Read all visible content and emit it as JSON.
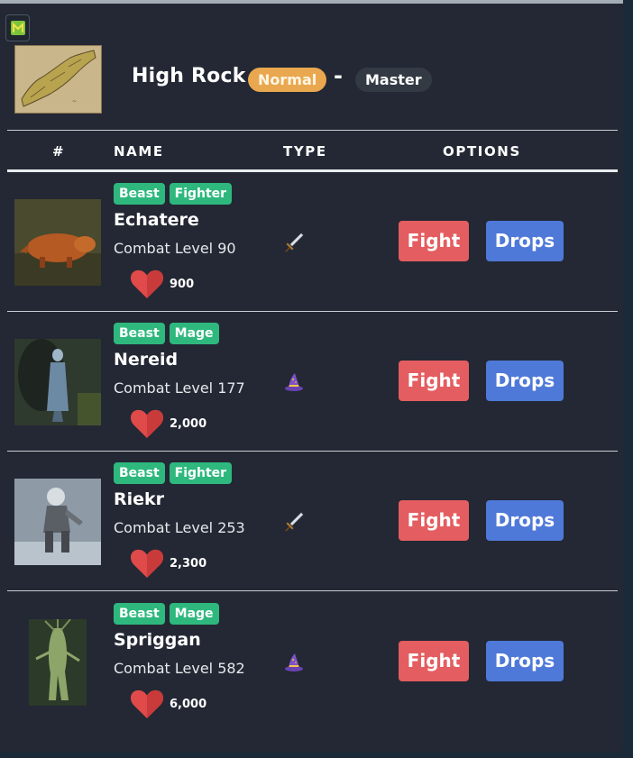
{
  "header": {
    "zone_name": "High Rock",
    "difficulty": "Normal",
    "separator": "-",
    "tier": "Master"
  },
  "table": {
    "columns": [
      "#",
      "NAME",
      "TYPE",
      "OPTIONS"
    ]
  },
  "monsters": [
    {
      "tags": [
        "Beast",
        "Fighter"
      ],
      "name": "Echatere",
      "level": "Combat Level 90",
      "hp": "900",
      "type_icon": "sword-icon",
      "fight": "Fight",
      "drops": "Drops"
    },
    {
      "tags": [
        "Beast",
        "Mage"
      ],
      "name": "Nereid",
      "level": "Combat Level 177",
      "hp": "2,000",
      "type_icon": "wizard-hat-icon",
      "fight": "Fight",
      "drops": "Drops"
    },
    {
      "tags": [
        "Beast",
        "Fighter"
      ],
      "name": "Riekr",
      "level": "Combat Level 253",
      "hp": "2,300",
      "type_icon": "sword-icon",
      "fight": "Fight",
      "drops": "Drops"
    },
    {
      "tags": [
        "Beast",
        "Mage"
      ],
      "name": "Spriggan",
      "level": "Combat Level 582",
      "hp": "6,000",
      "type_icon": "wizard-hat-icon",
      "fight": "Fight",
      "drops": "Drops"
    }
  ],
  "colors": {
    "panel_bg": "#232834",
    "tag_green": "#2eb87e",
    "fight_red": "#e45d60",
    "drops_blue": "#4f79d8",
    "normal_orange": "#e9a84f",
    "heart_red": "#e04a4a"
  }
}
